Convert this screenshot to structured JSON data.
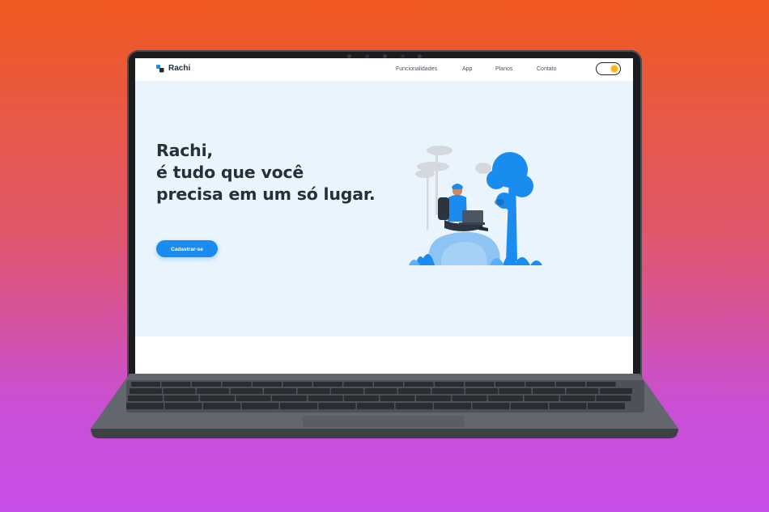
{
  "app": {
    "brand": "Rachi",
    "nav": {
      "links": [
        "Funcionalidades",
        "App",
        "Planos",
        "Contato"
      ],
      "theme_toggle_icon": "sun-icon"
    },
    "hero": {
      "headline_lines": [
        "Rachi,",
        "é tudo que você",
        "precisa em um só lugar."
      ],
      "cta_label": "Cadastrar-se",
      "illustration_icon": "person-with-laptop-on-rock-illustration"
    },
    "colors": {
      "accent": "#1a8cf0",
      "hero_bg": "#eaf4fd",
      "text_dark": "#25303d",
      "toggle_sun": "#f7b21c"
    }
  }
}
